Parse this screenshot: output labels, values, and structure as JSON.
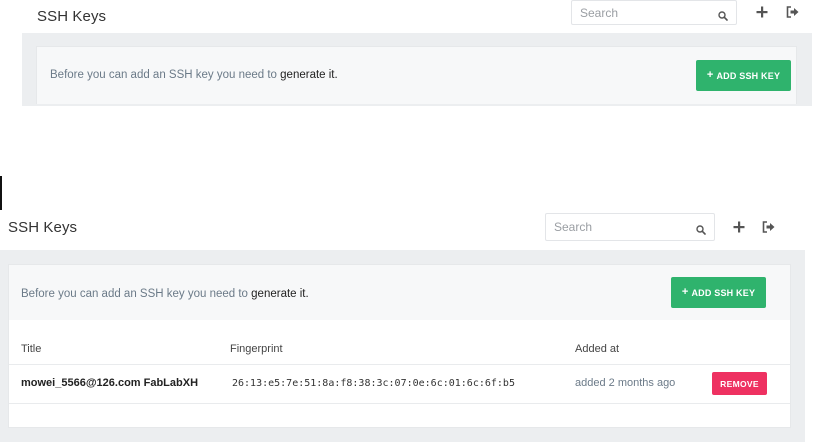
{
  "top": {
    "title": "SSH Keys",
    "search_placeholder": "Search",
    "notice_text": "Before you can add an SSH key you need to ",
    "notice_link": "generate it.",
    "add_button_label": "ADD SSH KEY"
  },
  "bottom": {
    "title": "SSH Keys",
    "search_placeholder": "Search",
    "notice_text": "Before you can add an SSH key you need to ",
    "notice_link": "generate it.",
    "add_button_label": "ADD SSH KEY",
    "table": {
      "columns": [
        "Title",
        "Fingerprint",
        "Added at"
      ],
      "rows": [
        {
          "title": "mowei_5566@126.com FabLabXH",
          "fingerprint": "26:13:e5:7e:51:8a:f8:38:3c:07:0e:6c:01:6c:6f:b5",
          "added": "added 2 months ago",
          "action": "REMOVE"
        }
      ]
    }
  },
  "colors": {
    "add_button": "#2fb36d",
    "remove_button": "#ee3161",
    "panel": "#eceef0",
    "card": "#f7f8f9"
  },
  "icons": {
    "search": "magnifier-icon",
    "add": "plus-icon",
    "logout": "sign-out-icon"
  }
}
